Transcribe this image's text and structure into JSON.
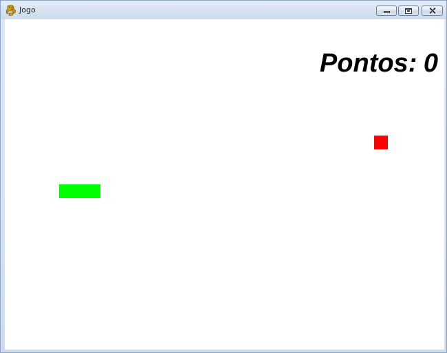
{
  "window": {
    "title": "Jogo",
    "icon": "python-snake-icon"
  },
  "controls": {
    "minimize_icon": "minimize-icon",
    "maximize_icon": "maximize-icon",
    "close_icon": "close-icon"
  },
  "score": {
    "label": "Pontos:",
    "value": "0"
  },
  "game": {
    "snake_color": "#00ff00",
    "food_color": "#ff0000",
    "background_color": "#ffffff",
    "snake_length": 3
  }
}
